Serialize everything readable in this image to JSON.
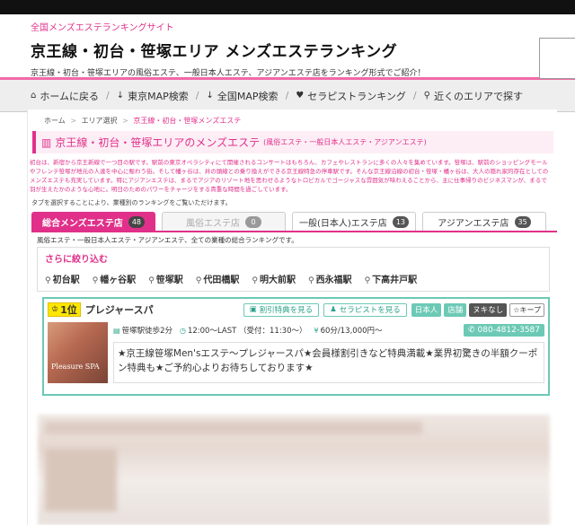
{
  "header": {
    "tag": "全国メンズエステランキングサイト",
    "title": "京王線・初台・笹塚エリア メンズエステランキング",
    "desc": "京王線・初台・笹塚エリアの風俗エステ、一般日本人エステ、アジアンエステ店をランキング形式でご紹介！"
  },
  "nav": {
    "home": "ホームに戻る",
    "tokyo_map": "東京MAP検索",
    "japan_map": "全国MAP検索",
    "therapist": "セラピストランキング",
    "nearby": "近くのエリアで探す"
  },
  "breadcrumb": {
    "home": "ホーム",
    "area": "エリア選択",
    "current": "京王線・初台・笹塚メンズエステ"
  },
  "section": {
    "title": "京王線・初台・笹塚エリアのメンズエステ",
    "subtitle": "(風俗エステ・一般日本人エステ・アジアンエステ)",
    "intro": "初台は、新宿から京王新線で一つ目の駅です。駅前の東京オペラシティにて開催されるコンサートはもちろん、カフェやレストランに多くの人々を集めています。笹塚は、駅前のショッピングモールやフレンテ笹塚が地元の人達を中心に賑わう街。そして幡ヶ谷は、井の頭線との乗り換えができる京王線特急の停車駅です。そんな京王線沿線の初台・笹塚・幡ヶ谷は、大人の隠れ家的存在としてのメンズエステも充実しています。特にアジアンエステは、まるでアジアのリゾート地を思わせるようなトロピカルでゴージャスな雰囲気が味わえることから、主に仕事帰りのビジネスマンが、まるで羽が生えたかのような心地に。明日のためのパワーをチャージをする貴重な時間を過ごしています。",
    "tab_note": "タブを選択することにより、業種別のランキングをご覧いただけます。"
  },
  "tabs": [
    {
      "label": "総合メンズエステ店",
      "count": "48"
    },
    {
      "label": "風俗エステ店",
      "count": "0"
    },
    {
      "label": "一般(日本人)エステ店",
      "count": "13"
    },
    {
      "label": "アジアンエステ店",
      "count": "35"
    }
  ],
  "tab_desc": "風俗エステ・一般日本人エステ・アジアンエステ、全ての業種の総合ランキングです。",
  "filter": {
    "title": "さらに絞り込む",
    "stations": [
      "初台駅",
      "幡ヶ谷駅",
      "笹塚駅",
      "代田橋駅",
      "明大前駅",
      "西永福駅",
      "下高井戸駅"
    ]
  },
  "shop": {
    "rank": "1位",
    "name": "プレジャースパ",
    "discount_btn": "割引特典を見る",
    "therapist_btn": "セラピストを見る",
    "badge_japanese": "日本人",
    "badge_store": "店舗",
    "badge_nuki": "ヌキなし",
    "keep": "☆キープ",
    "access": "笹塚駅徒歩2分",
    "hours": "12:00～LAST （受付：11:30～）",
    "price": "60分/13,000円～",
    "tel": "080-4812-3587",
    "logo": "Pleasure SPA",
    "catch": "★京王線笹塚Men'sエステ～プレジャースパ★会員様割引きなど特典満載★業界初驚きの半額クーポン特典も★ご予約心よりお待ちしております★"
  }
}
